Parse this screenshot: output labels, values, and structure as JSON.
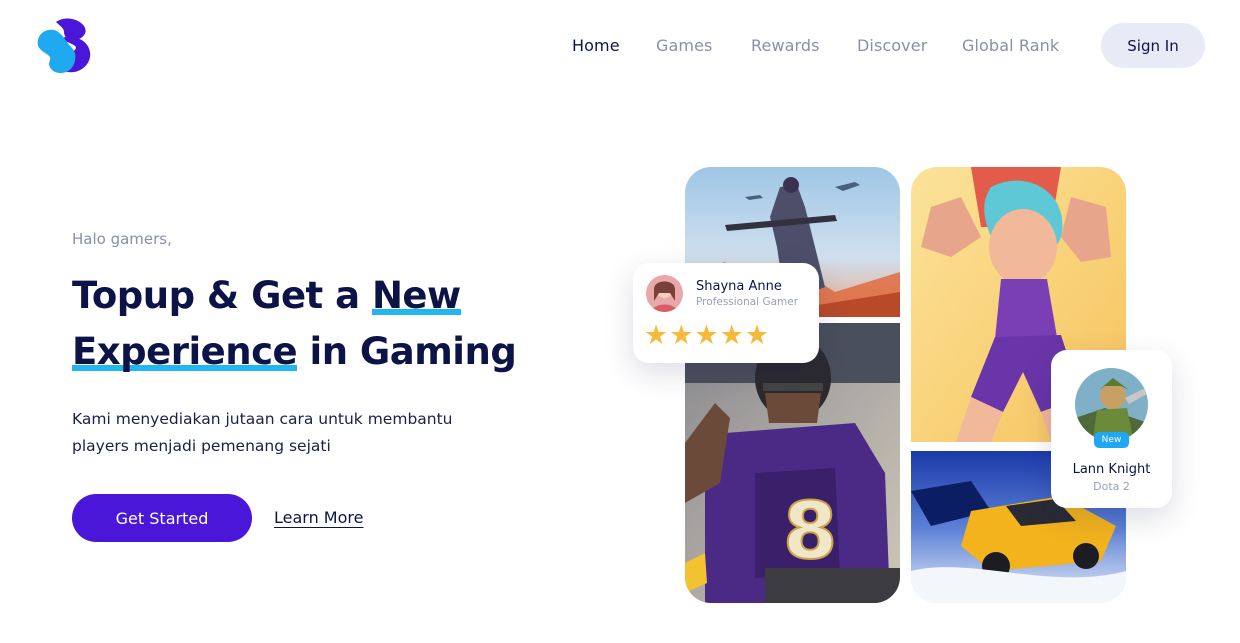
{
  "brand": {
    "logo_icon": "s-logo-icon",
    "colors": {
      "logo_blue": "#1fa9f0",
      "logo_purple": "#4a17d8"
    }
  },
  "nav": {
    "items": [
      {
        "label": "Home",
        "active": true
      },
      {
        "label": "Games",
        "active": false
      },
      {
        "label": "Rewards",
        "active": false
      },
      {
        "label": "Discover",
        "active": false
      },
      {
        "label": "Global Rank",
        "active": false
      }
    ],
    "signin_label": "Sign In"
  },
  "hero": {
    "greeting": "Halo gamers,",
    "headline": {
      "part1": "Topup & Get a ",
      "highlight1": "New",
      "highlight2": "Experience",
      "part2": " in Gaming"
    },
    "description": "Kami menyediakan jutaan cara untuk membantu players menjadi pemenang sejati",
    "primary_button": "Get Started",
    "secondary_link": "Learn More"
  },
  "cards": {
    "gamer": {
      "name": "Shayna Anne",
      "role": "Professional Gamer",
      "rating": 5,
      "stars": "★★★★★"
    },
    "player": {
      "name": "Lann Knight",
      "game": "Dota 2",
      "badge": "New"
    }
  },
  "colors": {
    "primary": "#4a17d8",
    "accent": "#22b6f0",
    "text_dark": "#0c1447",
    "text_muted": "#8a8fab",
    "star": "#f7b93a"
  }
}
